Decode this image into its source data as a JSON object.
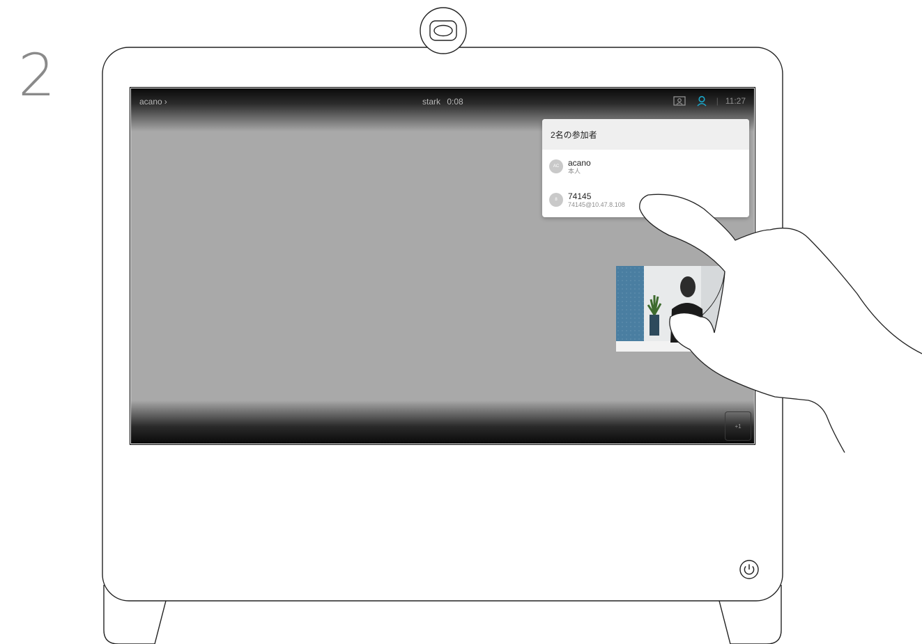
{
  "step": {
    "number": "2"
  },
  "call": {
    "name": "acano",
    "title": "stark",
    "duration": "0:08",
    "clock": "11:27",
    "overlay_badge": "+1"
  },
  "participants": {
    "header": "2名の参加者",
    "items": [
      {
        "initials": "AC",
        "name": "acano",
        "subtitle": "本人"
      },
      {
        "initials": "8",
        "name": "74145",
        "subtitle": "74145@10.47.8.108"
      }
    ]
  },
  "icons": {
    "camera": "camera-icon",
    "layout": "layout-icon",
    "participants": "participants-icon",
    "power": "power-icon",
    "chevron": "chevron-right-icon"
  },
  "colors": {
    "accent": "#1aa6c9",
    "screen": "#a9a9a9",
    "device_outline": "#222222"
  }
}
